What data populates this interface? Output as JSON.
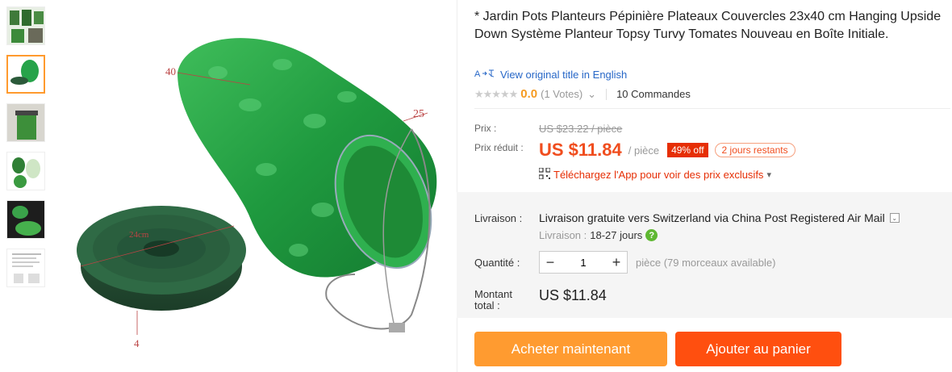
{
  "product": {
    "title": "* Jardin Pots Planteurs Pépinière Plateaux Couvercles 23x40 cm Hanging Upside Down Système Planteur Topsy Turvy Tomates Nouveau en Boîte Initiale.",
    "translate_link": "View original title in English",
    "rating_stars": "★★★★★",
    "rating_value": "0.0",
    "votes": "(1 Votes)",
    "votes_caret": "⌄",
    "orders": "10 Commandes"
  },
  "image_labels": {
    "dim_40": "40",
    "dim_25": "25",
    "dim_24": "24cm",
    "dim_4": "4"
  },
  "price": {
    "label": "Prix :",
    "old": "US $23.22 / pièce",
    "reduced_label": "Prix réduit :",
    "new": "US $11.84",
    "unit": "/ pièce",
    "discount": "49% off",
    "days_left": "2 jours restants",
    "app_promo": "Téléchargez l'App pour voir des prix exclusifs",
    "app_caret": "▾"
  },
  "shipping": {
    "label": "Livraison :",
    "main": "Livraison gratuite vers Switzerland via China Post Registered Air Mail",
    "caret": "⌄",
    "days_label": "Livraison :",
    "days": "18-27 jours",
    "help": "?"
  },
  "quantity": {
    "label": "Quantité :",
    "minus": "−",
    "value": "1",
    "plus": "+",
    "available": "pièce (79 morceaux available)"
  },
  "total": {
    "label_line1": "Montant",
    "label_line2": "total :",
    "value": "US $11.84"
  },
  "buttons": {
    "buy": "Acheter maintenant",
    "cart": "Ajouter au panier"
  },
  "colors": {
    "accent_orange": "#ff9b30",
    "cart_red": "#ff4f0f",
    "price_red": "#f04d1e",
    "link_blue": "#2767c7"
  }
}
